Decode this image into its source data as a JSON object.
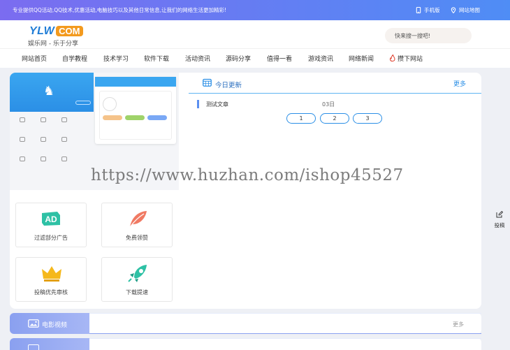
{
  "topbar": {
    "tagline": "专业提供QQ活动,QQ技术,优惠活动,电脑技巧以及其他日常信息,让我们的网络生活更加精彩!",
    "mobile": "手机版",
    "sitemap": "网站地图",
    "mobile_icon": "phone-icon",
    "sitemap_icon": "location-pin-icon"
  },
  "header": {
    "logo_text": "YLW",
    "logo_badge": "COM",
    "slogan": "娱乐网 - 乐于分享",
    "search_placeholder": "快来搜一搜吧!"
  },
  "nav": {
    "items": [
      "网站首页",
      "自学教程",
      "技术学习",
      "软件下载",
      "活动资讯",
      "源码分享",
      "值得一看",
      "游戏资讯",
      "网络新闻",
      "攒下网站"
    ],
    "hot_icon": "flame-icon"
  },
  "tiles": [
    {
      "label": "过滤部分广告",
      "icon": "ad-icon"
    },
    {
      "label": "免费领赞",
      "icon": "feather-icon"
    },
    {
      "label": "投稿优先审核",
      "icon": "crown-icon"
    },
    {
      "label": "下载提速",
      "icon": "rocket-icon"
    }
  ],
  "news": {
    "title": "今日更新",
    "more": "更多",
    "rows": [
      {
        "title": "测试文章",
        "date": "03日"
      }
    ],
    "pages": [
      "1",
      "2",
      "3"
    ]
  },
  "watermark": "https://www.huzhan.com/ishop45527",
  "sections": [
    {
      "label": "电影视频",
      "more": "更多"
    },
    {
      "label": "",
      "more": ""
    }
  ],
  "side_float": {
    "label": "投稿",
    "icon": "edit-icon"
  },
  "colors": {
    "accent": "#2b8fe6",
    "topbar_start": "#7b6cf0",
    "topbar_end": "#4f8df5",
    "logo_badge": "#f39a1e"
  }
}
